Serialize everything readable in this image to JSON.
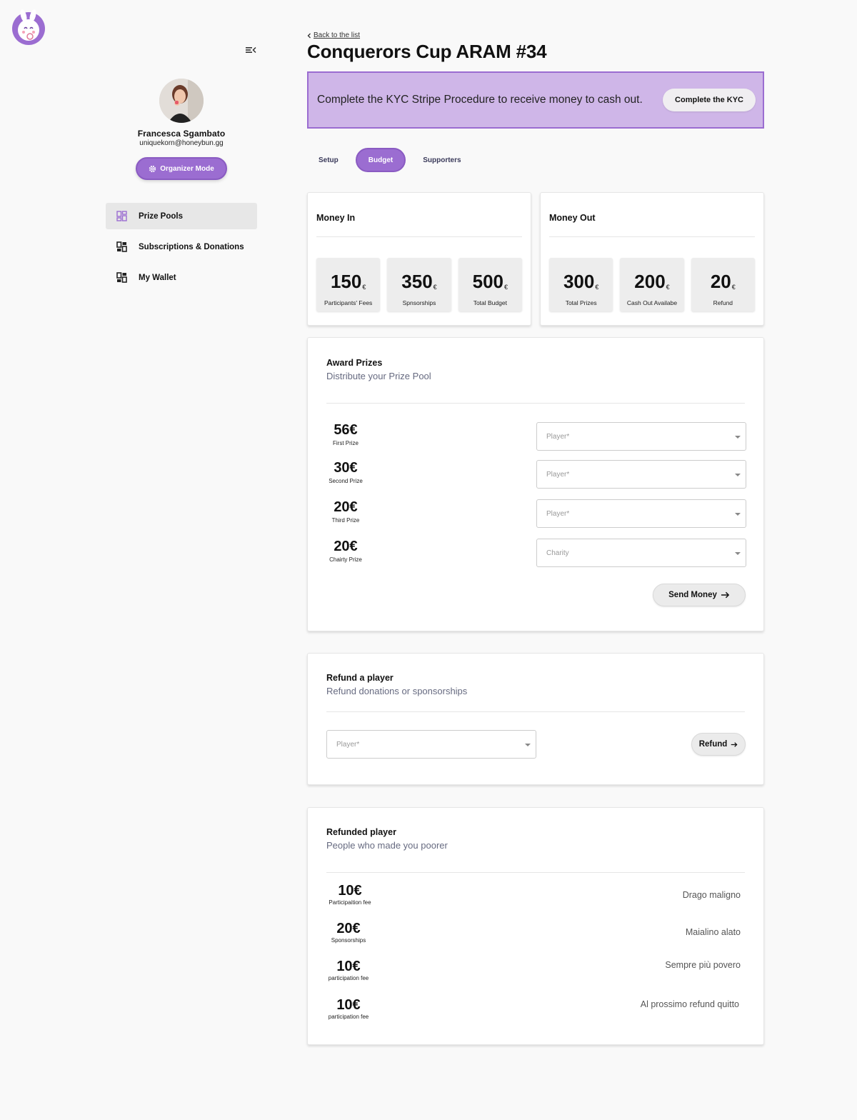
{
  "sidebar": {
    "profile": {
      "name": "Francesca Sgambato",
      "email": "uniquekorn@honeybun.gg",
      "mode_label": "Organizer Mode"
    },
    "nav": [
      {
        "label": "Prize Pools",
        "icon": "dashboard-icon"
      },
      {
        "label": "Subscriptions & Donations",
        "icon": "dashboard-icon"
      },
      {
        "label": "My Wallet",
        "icon": "dashboard-icon"
      }
    ]
  },
  "header": {
    "back_label": "Back to the list",
    "title": "Conquerors Cup ARAM #34"
  },
  "kyc_banner": {
    "text": "Complete the KYC Stripe Procedure to receive money to cash out.",
    "button": "Complete the KYC"
  },
  "tabs": [
    "Setup",
    "Budget",
    "Supporters"
  ],
  "money_in": {
    "title": "Money In",
    "stats": [
      {
        "value": "150",
        "unit": "€",
        "label": "Participants' Fees"
      },
      {
        "value": "350",
        "unit": "€",
        "label": "Spnsorships"
      },
      {
        "value": "500",
        "unit": "€",
        "label": "Total Budget"
      }
    ]
  },
  "money_out": {
    "title": "Money Out",
    "stats": [
      {
        "value": "300",
        "unit": "€",
        "label": "Total Prizes"
      },
      {
        "value": "200",
        "unit": "€",
        "label": "Cash Out Availabe"
      },
      {
        "value": "20",
        "unit": "€",
        "label": "Refund"
      }
    ]
  },
  "award": {
    "title": "Award Prizes",
    "subtitle": "Distribute your Prize Pool",
    "prizes": [
      {
        "amount": "56€",
        "label": "First  Prize",
        "placeholder": "Player*"
      },
      {
        "amount": "30€",
        "label": "Second  Prize",
        "placeholder": "Player*"
      },
      {
        "amount": "20€",
        "label": "Third  Prize",
        "placeholder": "Player*"
      },
      {
        "amount": "20€",
        "label": "Chairty  Prize",
        "placeholder": "Charity"
      }
    ],
    "send_button": "Send Money"
  },
  "refund": {
    "title": "Refund a player",
    "subtitle": "Refund donations or sponsorships",
    "placeholder": "Player*",
    "button": "Refund"
  },
  "refunded": {
    "title": "Refunded player",
    "subtitle": "People who made you poorer",
    "rows": [
      {
        "amount": "10€",
        "label": "Participaition fee",
        "name": "Drago maligno"
      },
      {
        "amount": "20€",
        "label": "Sponsorships",
        "name": "Maialino alato"
      },
      {
        "amount": "10€",
        "label": "participation fee",
        "name": "Sempre più povero"
      },
      {
        "amount": "10€",
        "label": "participation fee",
        "name": "Al prossimo refund quitto"
      }
    ]
  },
  "colors": {
    "accent": "#9b6dd1",
    "banner": "#cfb6e8"
  }
}
